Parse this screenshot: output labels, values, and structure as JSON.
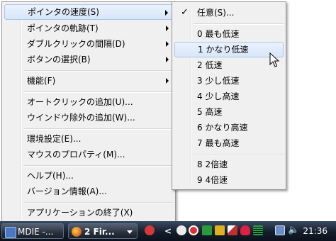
{
  "main_menu": {
    "items": [
      {
        "label": "ポインタの速度(S)"
      },
      {
        "label": "ポインタの軌跡(T)"
      },
      {
        "label": "ダブルクリックの間隔(D)"
      },
      {
        "label": "ボタンの選択(B)"
      },
      {
        "label": "機能(F)"
      },
      {
        "label": "オートクリックの追加(U)..."
      },
      {
        "label": "ウインドウ除外の追加(W)..."
      },
      {
        "label": "環境設定(E)..."
      },
      {
        "label": "マウスのプロパティ(M)..."
      },
      {
        "label": "ヘルプ(H)..."
      },
      {
        "label": "バージョン情報(A)..."
      },
      {
        "label": "アプリケーションの終了(X)"
      }
    ]
  },
  "sub_menu": {
    "checkmark": "✓",
    "items": [
      {
        "label": "任意(S)..."
      },
      {
        "label": "0 最も低速"
      },
      {
        "label": "1 かなり低速"
      },
      {
        "label": "2 低速"
      },
      {
        "label": "3 少し低速"
      },
      {
        "label": "4 少し高速"
      },
      {
        "label": "5 高速"
      },
      {
        "label": "6 かなり高速"
      },
      {
        "label": "7 最も高速"
      },
      {
        "label": "8 2倍速"
      },
      {
        "label": "9 4倍速"
      }
    ]
  },
  "taskbar": {
    "buttons": [
      {
        "label": "MDIE -...",
        "icon": "app-window-icon"
      },
      {
        "label": "2 Fir...",
        "icon": "firefox-icon"
      }
    ],
    "tray_arrow": "<",
    "clock": "21:36"
  }
}
